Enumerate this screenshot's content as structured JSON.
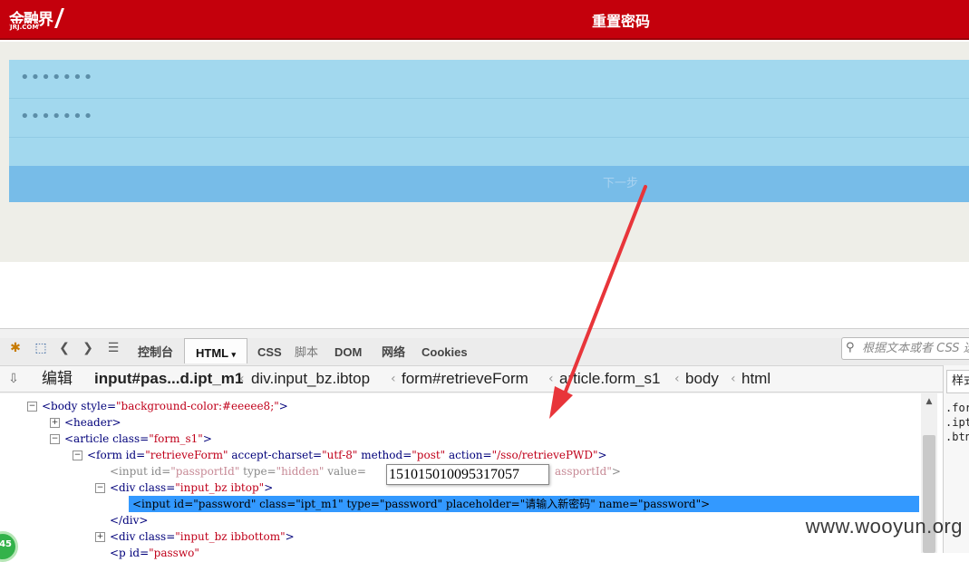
{
  "header": {
    "logo_text": "金融界",
    "logo_sub": "JRJ.COM",
    "title": "重置密码"
  },
  "form": {
    "password_mask": "•••••••",
    "confirm_mask": "•••••••",
    "next_label": "下一步"
  },
  "devtools": {
    "tabs": [
      "控制台",
      "HTML",
      "CSS",
      "脚本",
      "DOM",
      "网络",
      "Cookies"
    ],
    "search_placeholder": "根据文本或者 CSS 选",
    "edit_label": "编辑",
    "breadcrumbs": [
      "input#pas...d.ipt_m1",
      "div.input_bz.ibtop",
      "form#retrieveForm",
      "article.form_s1",
      "body",
      "html"
    ],
    "side_tab": "样式",
    "side_lines": [
      ".form",
      ".ipt",
      ".btn"
    ],
    "tree": {
      "body_style": "background-color:#eeeee8;",
      "form_id": "retrieveForm",
      "form_charset": "utf-8",
      "form_method": "post",
      "form_action": "/sso/retrievePWD",
      "hidden_id": "passportId",
      "hidden_type": "hidden",
      "hidden_name_tail": "assportId",
      "div1_class": "input_bz ibtop",
      "article_class": "form_s1",
      "input_id": "password",
      "input_class": "ipt_m1",
      "input_type": "password",
      "input_placeholder": "请输入新密码",
      "input_name": "password",
      "div2_class": "input_bz ibbottom",
      "p_id": "passwo"
    },
    "tooltip_value": "151015010095317057"
  },
  "watermark": "www.wooyun.org",
  "badge": "45",
  "colors": {
    "header_red": "#c4000c",
    "form_blue": "#a2d8ee",
    "button_blue": "#77bce8",
    "arrow_red": "#e8353a",
    "selection": "#3399ff"
  }
}
